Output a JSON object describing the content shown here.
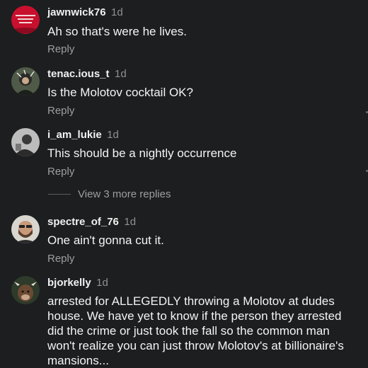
{
  "comments": [
    {
      "username": "jawnwick76",
      "time": "1d",
      "text": "Ah so that's were he lives.",
      "reply": "Reply",
      "avatar": "red-hat-avatar"
    },
    {
      "username": "tenac.ious_t",
      "time": "1d",
      "text": "Is the Molotov cocktail OK?",
      "reply": "Reply",
      "avatar": "photo-avatar"
    },
    {
      "username": "i_am_lukie",
      "time": "1d",
      "text": "This should be a nightly occurrence",
      "reply": "Reply",
      "avatar": "grayscale-photo-avatar"
    },
    {
      "username": "spectre_of_76",
      "time": "1d",
      "text": "One ain't gonna cut it.",
      "reply": "Reply",
      "avatar": "bearded-man-avatar"
    },
    {
      "username": "bjorkelly",
      "time": "1d",
      "text": "arrested for ALLEGEDLY throwing a Molotov at dudes house. We have yet to know if the person they arrested did the crime or just took the fall so the common man won't realize you can just throw Molotov's at billionaire's mansions...",
      "avatar": "animal-photo-avatar"
    }
  ],
  "view_more_replies": "View 3 more replies",
  "colors": {
    "background": "#1c1e1f",
    "text": "#f1f1f1",
    "muted": "#9c9fa3",
    "hat_red": "#c8102e"
  }
}
